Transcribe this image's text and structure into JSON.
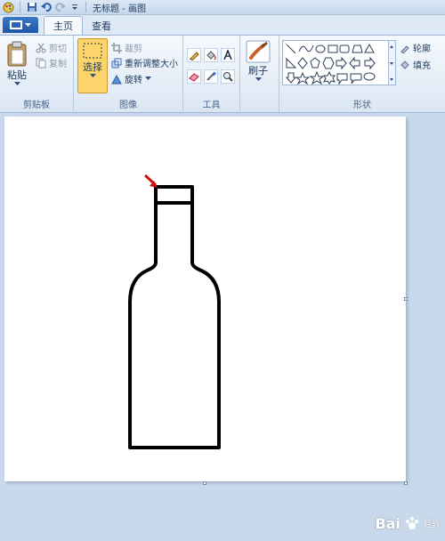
{
  "window": {
    "title": "无标题 - 画图"
  },
  "tabs": [
    {
      "label": "主页"
    },
    {
      "label": "查看"
    }
  ],
  "ribbon": {
    "clipboard": {
      "paste": "粘贴",
      "cut": "剪切",
      "copy": "复制",
      "group_label": "剪贴板"
    },
    "image": {
      "select": "选择",
      "crop": "裁剪",
      "resize": "重新调整大小",
      "rotate": "旋转",
      "group_label": "图像"
    },
    "tools": {
      "group_label": "工具"
    },
    "brushes": {
      "label": "刷子"
    },
    "shapes": {
      "outline": "轮廓",
      "fill": "填充",
      "group_label": "形状"
    }
  },
  "watermark": {
    "text": "Bai",
    "sub": "经验"
  },
  "colors": {
    "selected_tool_bg": "#fbd46b",
    "arrow_red": "#cc1111"
  }
}
